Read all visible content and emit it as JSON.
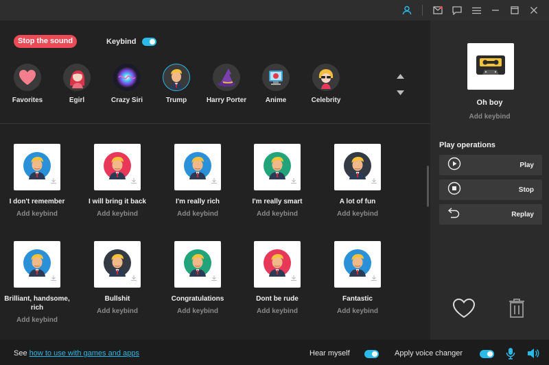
{
  "controls": {
    "stop_label": "Stop the sound",
    "keybind_label": "Keybind"
  },
  "categories": [
    {
      "label": "Favorites",
      "icon": "heart-icon"
    },
    {
      "label": "Egirl",
      "icon": "egirl-avatar"
    },
    {
      "label": "Crazy Siri",
      "icon": "siri-orb-icon"
    },
    {
      "label": "Trump",
      "icon": "trump-avatar",
      "active": true
    },
    {
      "label": "Harry Porter",
      "icon": "wizard-hat-icon"
    },
    {
      "label": "Anime",
      "icon": "anime-avatar"
    },
    {
      "label": "Celebrity",
      "icon": "celebrity-avatar"
    }
  ],
  "sounds": [
    {
      "title": "I don't remember",
      "keybind": "Add keybind",
      "bg": "#2a90d8"
    },
    {
      "title": "I will bring it back",
      "keybind": "Add keybind",
      "bg": "#e8385a"
    },
    {
      "title": "I'm really rich",
      "keybind": "Add keybind",
      "bg": "#2a90d8"
    },
    {
      "title": "I'm really smart",
      "keybind": "Add keybind",
      "bg": "#22a37a"
    },
    {
      "title": "A lot of fun",
      "keybind": "Add keybind",
      "bg": "#333a44"
    },
    {
      "title": "Brilliant, handsome, rich",
      "keybind": "Add keybind",
      "bg": "#2a90d8"
    },
    {
      "title": "Bullshit",
      "keybind": "Add keybind",
      "bg": "#333a44"
    },
    {
      "title": "Congratulations",
      "keybind": "Add keybind",
      "bg": "#22a37a"
    },
    {
      "title": "Dont be rude",
      "keybind": "Add keybind",
      "bg": "#e8385a"
    },
    {
      "title": "Fantastic",
      "keybind": "Add keybind",
      "bg": "#2a90d8"
    }
  ],
  "current": {
    "name": "Oh boy",
    "keybind": "Add keybind",
    "icon": "cassette-icon"
  },
  "play_operations": {
    "title": "Play operations",
    "buttons": [
      {
        "label": "Play",
        "icon": "play-icon"
      },
      {
        "label": "Stop",
        "icon": "stop-icon"
      },
      {
        "label": "Replay",
        "icon": "replay-icon"
      }
    ]
  },
  "bottom": {
    "see_prefix": "See ",
    "see_link": "how to use with games and apps",
    "hear_myself": "Hear myself",
    "apply_voice_changer": "Apply voice changer"
  },
  "colors": {
    "accent": "#2bb9e8",
    "stop": "#ea4b56"
  }
}
